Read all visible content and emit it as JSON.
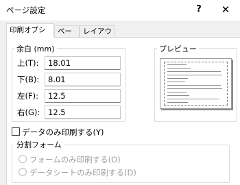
{
  "window": {
    "title": "ページ設定",
    "help_label": "?",
    "close_label": "✕"
  },
  "tabs": [
    {
      "label": "印刷オプション"
    },
    {
      "label": "ページ"
    },
    {
      "label": "レイアウト"
    }
  ],
  "margins": {
    "title": "余白 (mm)",
    "top_label": "上(T):",
    "top_value": "18.01",
    "bottom_label": "下(B):",
    "bottom_value": "8.01",
    "left_label": "左(F):",
    "left_value": "12.5",
    "right_label": "右(G):",
    "right_value": "12.5"
  },
  "preview": {
    "title": "プレビュー"
  },
  "print_data_only": {
    "label": "データのみ印刷する(Y)",
    "checked": false
  },
  "split_form": {
    "title": "分割フォーム",
    "options": [
      {
        "label": "フォームのみ印刷する(O)"
      },
      {
        "label": "データシートのみ印刷する(D)"
      }
    ]
  }
}
